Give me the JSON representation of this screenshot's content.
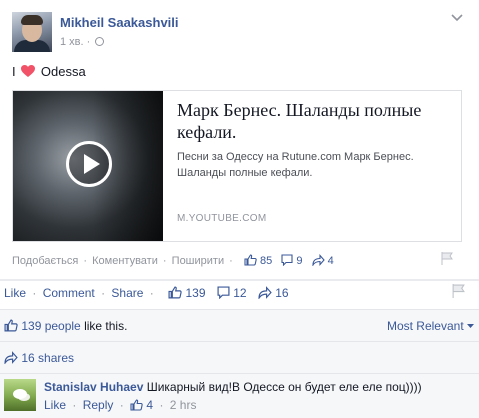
{
  "post": {
    "author": "Mikheil Saakashvili",
    "time": "1 хв.",
    "status_prefix": "I",
    "status_suffix": "Odessa",
    "attachment": {
      "title": "Марк Бернес. Шаланды полные кефали.",
      "description": "Песни за Одессу на Rutune.com Марк Бернес. Шаланды полные кефали.",
      "domain": "M.YOUTUBE.COM"
    },
    "inner_actions": {
      "like": "Подобається",
      "comment": "Коментувати",
      "share": "Поширити",
      "likes": "85",
      "comments": "9",
      "shares": "4"
    }
  },
  "actions": {
    "like": "Like",
    "comment": "Comment",
    "share": "Share",
    "likes": "139",
    "comments": "12",
    "shares": "16"
  },
  "ufi": {
    "likes_count": "139 people",
    "likes_text": " like this.",
    "sort": "Most Relevant",
    "shares_text": "16 shares"
  },
  "comment": {
    "author": "Stanislav Huhaev",
    "text": "Шикарный вид!В Одессе он будет еле еле поц))))",
    "like": "Like",
    "reply": "Reply",
    "likes": "4",
    "time": "2 hrs"
  },
  "colors": {
    "link": "#3b5998",
    "meta": "#90949c",
    "heart": "#f25268",
    "background_ufi": "#f6f7f9"
  }
}
